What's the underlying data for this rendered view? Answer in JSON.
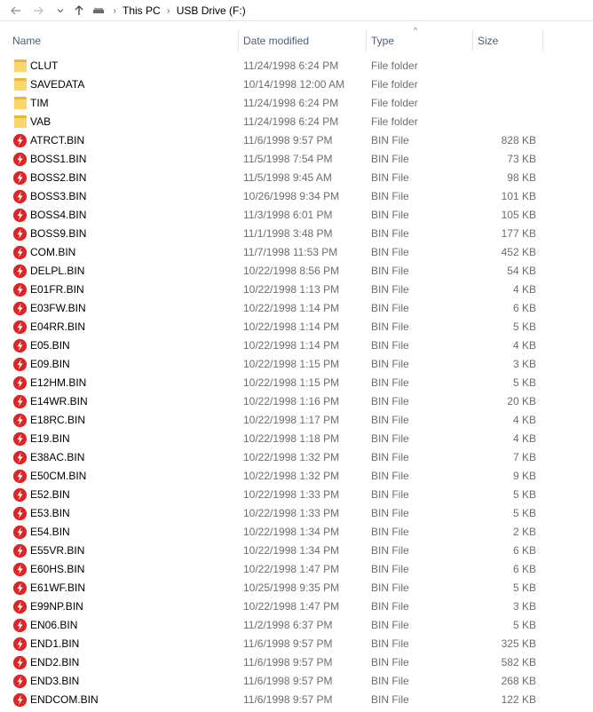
{
  "breadcrumb": [
    "This PC",
    "USB Drive (F:)"
  ],
  "columns": {
    "name": "Name",
    "date": "Date modified",
    "type": "Type",
    "size": "Size"
  },
  "colors": {
    "header_text": "#4c607a",
    "secondary_text": "#6d6d6d",
    "folder": "#fcd56b",
    "bin_icon": "#e02424"
  },
  "files": [
    {
      "name": "CLUT",
      "date": "11/24/1998 6:24 PM",
      "type": "File folder",
      "size": "",
      "icon": "folder-icon"
    },
    {
      "name": "SAVEDATA",
      "date": "10/14/1998 12:00 AM",
      "type": "File folder",
      "size": "",
      "icon": "folder-icon"
    },
    {
      "name": "TIM",
      "date": "11/24/1998 6:24 PM",
      "type": "File folder",
      "size": "",
      "icon": "folder-icon"
    },
    {
      "name": "VAB",
      "date": "11/24/1998 6:24 PM",
      "type": "File folder",
      "size": "",
      "icon": "folder-icon"
    },
    {
      "name": "ATRCT.BIN",
      "date": "11/6/1998 9:57 PM",
      "type": "BIN File",
      "size": "828 KB",
      "icon": "bin-file-icon"
    },
    {
      "name": "BOSS1.BIN",
      "date": "11/5/1998 7:54 PM",
      "type": "BIN File",
      "size": "73 KB",
      "icon": "bin-file-icon"
    },
    {
      "name": "BOSS2.BIN",
      "date": "11/5/1998 9:45 AM",
      "type": "BIN File",
      "size": "98 KB",
      "icon": "bin-file-icon"
    },
    {
      "name": "BOSS3.BIN",
      "date": "10/26/1998 9:34 PM",
      "type": "BIN File",
      "size": "101 KB",
      "icon": "bin-file-icon"
    },
    {
      "name": "BOSS4.BIN",
      "date": "11/3/1998 6:01 PM",
      "type": "BIN File",
      "size": "105 KB",
      "icon": "bin-file-icon"
    },
    {
      "name": "BOSS9.BIN",
      "date": "11/1/1998 3:48 PM",
      "type": "BIN File",
      "size": "177 KB",
      "icon": "bin-file-icon"
    },
    {
      "name": "COM.BIN",
      "date": "11/7/1998 11:53 PM",
      "type": "BIN File",
      "size": "452 KB",
      "icon": "bin-file-icon"
    },
    {
      "name": "DELPL.BIN",
      "date": "10/22/1998 8:56 PM",
      "type": "BIN File",
      "size": "54 KB",
      "icon": "bin-file-icon"
    },
    {
      "name": "E01FR.BIN",
      "date": "10/22/1998 1:13 PM",
      "type": "BIN File",
      "size": "4 KB",
      "icon": "bin-file-icon"
    },
    {
      "name": "E03FW.BIN",
      "date": "10/22/1998 1:14 PM",
      "type": "BIN File",
      "size": "6 KB",
      "icon": "bin-file-icon"
    },
    {
      "name": "E04RR.BIN",
      "date": "10/22/1998 1:14 PM",
      "type": "BIN File",
      "size": "5 KB",
      "icon": "bin-file-icon"
    },
    {
      "name": "E05.BIN",
      "date": "10/22/1998 1:14 PM",
      "type": "BIN File",
      "size": "4 KB",
      "icon": "bin-file-icon"
    },
    {
      "name": "E09.BIN",
      "date": "10/22/1998 1:15 PM",
      "type": "BIN File",
      "size": "3 KB",
      "icon": "bin-file-icon"
    },
    {
      "name": "E12HM.BIN",
      "date": "10/22/1998 1:15 PM",
      "type": "BIN File",
      "size": "5 KB",
      "icon": "bin-file-icon"
    },
    {
      "name": "E14WR.BIN",
      "date": "10/22/1998 1:16 PM",
      "type": "BIN File",
      "size": "20 KB",
      "icon": "bin-file-icon"
    },
    {
      "name": "E18RC.BIN",
      "date": "10/22/1998 1:17 PM",
      "type": "BIN File",
      "size": "4 KB",
      "icon": "bin-file-icon"
    },
    {
      "name": "E19.BIN",
      "date": "10/22/1998 1:18 PM",
      "type": "BIN File",
      "size": "4 KB",
      "icon": "bin-file-icon"
    },
    {
      "name": "E38AC.BIN",
      "date": "10/22/1998 1:32 PM",
      "type": "BIN File",
      "size": "7 KB",
      "icon": "bin-file-icon"
    },
    {
      "name": "E50CM.BIN",
      "date": "10/22/1998 1:32 PM",
      "type": "BIN File",
      "size": "9 KB",
      "icon": "bin-file-icon"
    },
    {
      "name": "E52.BIN",
      "date": "10/22/1998 1:33 PM",
      "type": "BIN File",
      "size": "5 KB",
      "icon": "bin-file-icon"
    },
    {
      "name": "E53.BIN",
      "date": "10/22/1998 1:33 PM",
      "type": "BIN File",
      "size": "5 KB",
      "icon": "bin-file-icon"
    },
    {
      "name": "E54.BIN",
      "date": "10/22/1998 1:34 PM",
      "type": "BIN File",
      "size": "2 KB",
      "icon": "bin-file-icon"
    },
    {
      "name": "E55VR.BIN",
      "date": "10/22/1998 1:34 PM",
      "type": "BIN File",
      "size": "6 KB",
      "icon": "bin-file-icon"
    },
    {
      "name": "E60HS.BIN",
      "date": "10/22/1998 1:47 PM",
      "type": "BIN File",
      "size": "6 KB",
      "icon": "bin-file-icon"
    },
    {
      "name": "E61WF.BIN",
      "date": "10/25/1998 9:35 PM",
      "type": "BIN File",
      "size": "5 KB",
      "icon": "bin-file-icon"
    },
    {
      "name": "E99NP.BIN",
      "date": "10/22/1998 1:47 PM",
      "type": "BIN File",
      "size": "3 KB",
      "icon": "bin-file-icon"
    },
    {
      "name": "EN06.BIN",
      "date": "11/2/1998 6:37 PM",
      "type": "BIN File",
      "size": "5 KB",
      "icon": "bin-file-icon"
    },
    {
      "name": "END1.BIN",
      "date": "11/6/1998 9:57 PM",
      "type": "BIN File",
      "size": "325 KB",
      "icon": "bin-file-icon"
    },
    {
      "name": "END2.BIN",
      "date": "11/6/1998 9:57 PM",
      "type": "BIN File",
      "size": "582 KB",
      "icon": "bin-file-icon"
    },
    {
      "name": "END3.BIN",
      "date": "11/6/1998 9:57 PM",
      "type": "BIN File",
      "size": "268 KB",
      "icon": "bin-file-icon"
    },
    {
      "name": "ENDCOM.BIN",
      "date": "11/6/1998 9:57 PM",
      "type": "BIN File",
      "size": "122 KB",
      "icon": "bin-file-icon"
    }
  ]
}
